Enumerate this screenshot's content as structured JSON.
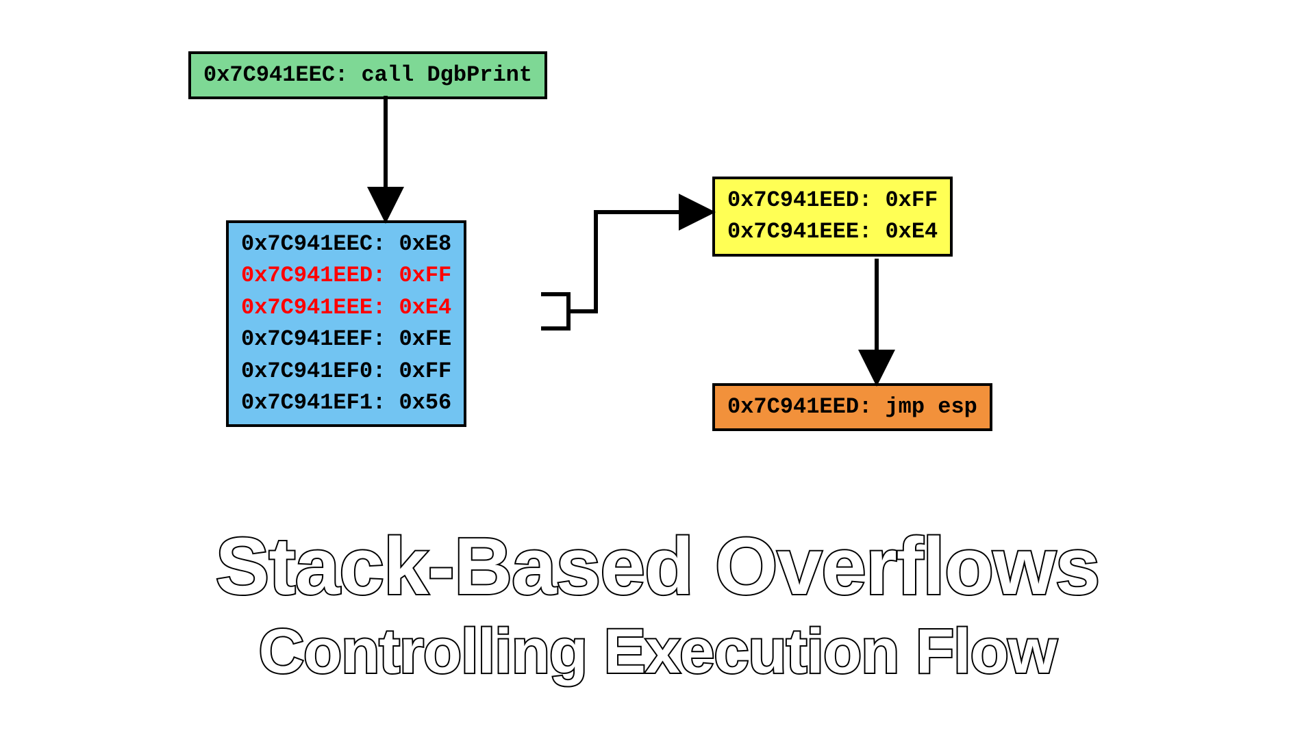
{
  "boxes": {
    "green": {
      "text": "0x7C941EEC: call DgbPrint"
    },
    "blue": {
      "rows": [
        {
          "text": "0x7C941EEC: 0xE8",
          "red": false
        },
        {
          "text": "0x7C941EED: 0xFF",
          "red": true
        },
        {
          "text": "0x7C941EEE: 0xE4",
          "red": true
        },
        {
          "text": "0x7C941EEF: 0xFE",
          "red": false
        },
        {
          "text": "0x7C941EF0: 0xFF",
          "red": false
        },
        {
          "text": "0x7C941EF1: 0x56",
          "red": false
        }
      ]
    },
    "yellow": {
      "rows": [
        {
          "text": "0x7C941EED: 0xFF"
        },
        {
          "text": "0x7C941EEE: 0xE4"
        }
      ]
    },
    "orange": {
      "text": "0x7C941EED: jmp esp"
    }
  },
  "title": {
    "line1": "Stack-Based Overflows",
    "line2": "Controlling Execution Flow"
  },
  "colors": {
    "green": "#7ed895",
    "blue": "#72c4f2",
    "yellow": "#ffff55",
    "orange": "#f2913b",
    "highlight": "#ff0000"
  }
}
